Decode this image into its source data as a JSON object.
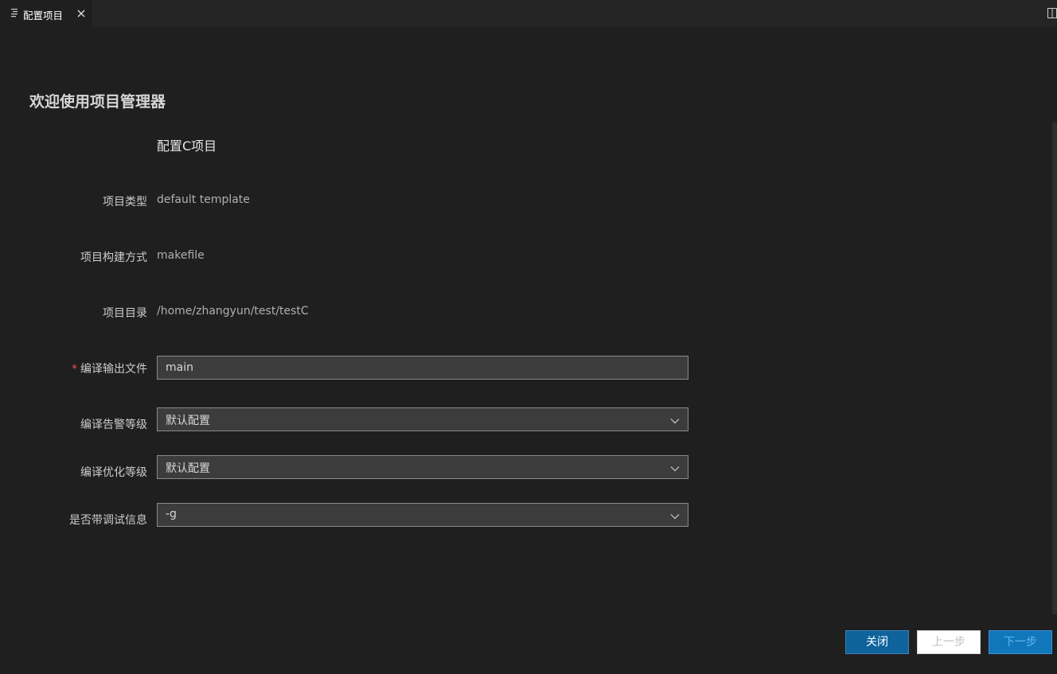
{
  "tab": {
    "title": "配置项目",
    "icon": "document-icon",
    "close_icon": "close-icon"
  },
  "editor_actions": {
    "split_icon": "split-editor-icon"
  },
  "page": {
    "welcome": "欢迎使用项目管理器",
    "section_title": "配置C项目"
  },
  "form": {
    "project_type": {
      "label": "项目类型",
      "value": "default template"
    },
    "build_method": {
      "label": "项目构建方式",
      "value": "makefile"
    },
    "project_dir": {
      "label": "项目目录",
      "value": "/home/zhangyun/test/testC"
    },
    "output_file": {
      "required_mark": "*",
      "label": "编译输出文件",
      "value": "main"
    },
    "warning_level": {
      "label": "编译告警等级",
      "selected": "默认配置"
    },
    "optimize_level": {
      "label": "编译优化等级",
      "selected": "默认配置"
    },
    "debug_info": {
      "label": "是否带调试信息",
      "selected": "-g"
    }
  },
  "buttons": {
    "close": "关闭",
    "prev": "上一步",
    "next": "下一步"
  },
  "colors": {
    "background": "#1f1f1f",
    "tabbar": "#252526",
    "primary_button": "#0e639c",
    "required": "#f14c4c"
  }
}
